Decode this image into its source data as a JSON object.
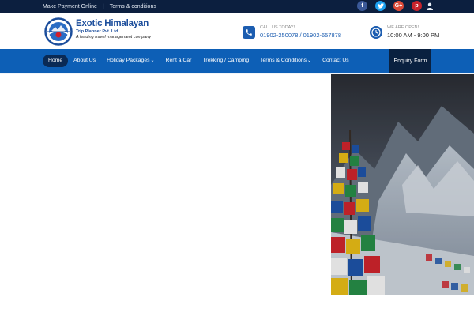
{
  "topbar": {
    "links": [
      "Make Payment Online",
      "Terms & conditions"
    ],
    "separator": "|",
    "social": [
      {
        "name": "facebook",
        "glyph": "f"
      },
      {
        "name": "twitter",
        "glyph": "t"
      },
      {
        "name": "google-plus",
        "glyph": "G+"
      },
      {
        "name": "pinterest",
        "glyph": "p"
      }
    ]
  },
  "brand": {
    "name": "Exotic Himalayan",
    "sub": "Trip Planner Pvt. Ltd.",
    "tagline": "A leading travel management company"
  },
  "contact": {
    "call_label": "CALL US TODAY!",
    "phones": "01902-250078 / 01902-657878",
    "open_label": "WE ARE OPEN!",
    "hours": "10:00 AM - 9:00 PM"
  },
  "nav": {
    "items": [
      {
        "label": "Home",
        "active": true,
        "dropdown": false
      },
      {
        "label": "About Us",
        "active": false,
        "dropdown": false
      },
      {
        "label": "Holiday Packages",
        "active": false,
        "dropdown": true
      },
      {
        "label": "Rent a Car",
        "active": false,
        "dropdown": false
      },
      {
        "label": "Trekking / Camping",
        "active": false,
        "dropdown": false
      },
      {
        "label": "Terms & Conditions",
        "active": false,
        "dropdown": true
      },
      {
        "label": "Contact Us",
        "active": false,
        "dropdown": false
      }
    ],
    "enquiry": "Enquiry Form"
  },
  "colors": {
    "topbar": "#0c1f3f",
    "nav": "#0d5fb6",
    "nav_active": "#0a2a55",
    "brand_blue": "#1c4e9c"
  }
}
